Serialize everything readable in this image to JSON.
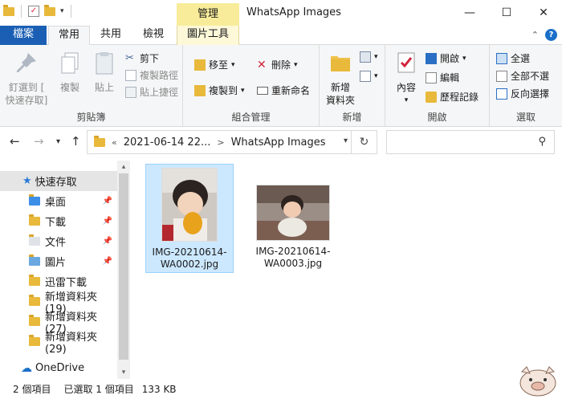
{
  "window": {
    "title": "WhatsApp Images",
    "context_tab": "管理",
    "minimize": "—",
    "maximize": "☐",
    "close": "✕"
  },
  "tabs": {
    "file": "檔案",
    "home": "常用",
    "share": "共用",
    "view": "檢視",
    "picture_tools": "圖片工具"
  },
  "ribbon": {
    "clipboard": {
      "label": "剪貼簿",
      "pin": "釘選到 [\n快速存取]",
      "pin_line1": "釘選到 [",
      "pin_line2": "快速存取]",
      "copy": "複製",
      "paste": "貼上",
      "cut": "剪下",
      "copy_path": "複製路徑",
      "paste_shortcut": "貼上捷徑"
    },
    "organize": {
      "label": "組合管理",
      "move_to": "移至",
      "copy_to": "複製到",
      "delete": "刪除",
      "rename": "重新命名"
    },
    "new": {
      "label": "新增",
      "new_folder_line1": "新增",
      "new_folder_line2": "資料夾"
    },
    "open": {
      "label": "開啟",
      "properties": "內容",
      "open": "開啟",
      "edit": "編輯",
      "history": "歷程記錄"
    },
    "select": {
      "label": "選取",
      "select_all": "全選",
      "select_none": "全部不選",
      "invert": "反向選擇"
    }
  },
  "address": {
    "prefix": "«",
    "crumb1": "2021-06-14 22...",
    "crumb2": "WhatsApp Images"
  },
  "sidebar": {
    "items": [
      {
        "label": "快速存取",
        "icon": "star-icon"
      },
      {
        "label": "桌面",
        "icon": "desktop-folder-icon",
        "pinned": true
      },
      {
        "label": "下載",
        "icon": "download-folder-icon",
        "pinned": true
      },
      {
        "label": "文件",
        "icon": "documents-folder-icon",
        "pinned": true
      },
      {
        "label": "圖片",
        "icon": "pictures-folder-icon",
        "pinned": true
      },
      {
        "label": "迅雷下載",
        "icon": "folder-icon"
      },
      {
        "label": "新增資料夾 (19)",
        "icon": "folder-icon"
      },
      {
        "label": "新增資料夾 (27)",
        "icon": "folder-icon"
      },
      {
        "label": "新增資料夾 (29)",
        "icon": "folder-icon"
      },
      {
        "label": "OneDrive",
        "icon": "cloud-icon"
      }
    ]
  },
  "files": [
    {
      "name_line1": "IMG-20210614-",
      "name_line2": "WA0002.jpg",
      "selected": true
    },
    {
      "name_line1": "IMG-20210614-",
      "name_line2": "WA0003.jpg",
      "selected": false
    }
  ],
  "status": {
    "count": "2 個項目",
    "selected": "已選取 1 個項目",
    "size": "133 KB"
  },
  "colors": {
    "accent": "#1a5fb4",
    "context_tab": "#f8ec9a",
    "selection": "#cce8ff"
  }
}
